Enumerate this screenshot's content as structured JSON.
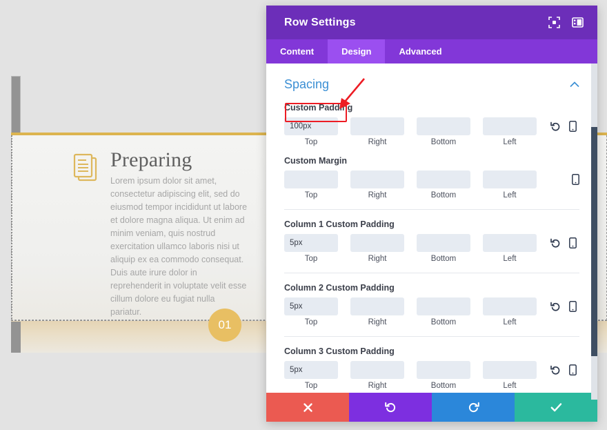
{
  "canvas": {
    "heading": "Preparing",
    "body": "Lorem ipsum dolor sit amet, consectetur adipiscing elit, sed do eiusmod tempor incididunt ut labore et dolore magna aliqua. Ut enim ad minim veniam, quis nostrud exercitation ullamco laboris nisi ut aliquip ex ea commodo consequat. Duis aute irure dolor in reprehenderit in voluptate velit esse cillum dolore eu fugiat nulla pariatur.",
    "badge_number": "01",
    "icon_name": "documents-icon",
    "accent_gold": "#dcb44f",
    "badge_color": "#e8bf63"
  },
  "modal": {
    "title": "Row Settings",
    "header_icons": [
      {
        "name": "focus-icon",
        "glyph": "⬚"
      },
      {
        "name": "layout-columns-icon",
        "glyph": "▣"
      }
    ],
    "tabs": [
      {
        "label": "Content",
        "active": false
      },
      {
        "label": "Design",
        "active": true
      },
      {
        "label": "Advanced",
        "active": false
      }
    ],
    "section": {
      "title": "Spacing",
      "collapse_glyph": "⌃",
      "accent": "#3b8fd4"
    },
    "groups": [
      {
        "label": "Custom Padding",
        "values": [
          "100px",
          "",
          "",
          ""
        ],
        "captions": [
          "Top",
          "Right",
          "Bottom",
          "Left"
        ],
        "has_reset": true,
        "has_device": true,
        "highlighted": true
      },
      {
        "label": "Custom Margin",
        "values": [
          "",
          "",
          "",
          ""
        ],
        "captions": [
          "Top",
          "Right",
          "Bottom",
          "Left"
        ],
        "has_reset": false,
        "has_device": true,
        "highlighted": false
      },
      {
        "label": "Column 1 Custom Padding",
        "values": [
          "5px",
          "",
          "",
          ""
        ],
        "captions": [
          "Top",
          "Right",
          "Bottom",
          "Left"
        ],
        "has_reset": true,
        "has_device": true,
        "highlighted": false
      },
      {
        "label": "Column 2 Custom Padding",
        "values": [
          "5px",
          "",
          "",
          ""
        ],
        "captions": [
          "Top",
          "Right",
          "Bottom",
          "Left"
        ],
        "has_reset": true,
        "has_device": true,
        "highlighted": false
      },
      {
        "label": "Column 3 Custom Padding",
        "values": [
          "5px",
          "",
          "",
          ""
        ],
        "captions": [
          "Top",
          "Right",
          "Bottom",
          "Left"
        ],
        "has_reset": true,
        "has_device": true,
        "highlighted": false
      }
    ],
    "footer": [
      {
        "name": "cancel-button",
        "glyph": "✖",
        "color": "#eb5a51"
      },
      {
        "name": "undo-button",
        "glyph": "↺",
        "color": "#7d2fe0"
      },
      {
        "name": "redo-button",
        "glyph": "↻",
        "color": "#2b87da"
      },
      {
        "name": "save-button",
        "glyph": "✔",
        "color": "#2bb99e"
      }
    ],
    "annotation": {
      "highlight_color": "#ed1c24",
      "target": "Custom Padding Top field"
    }
  }
}
